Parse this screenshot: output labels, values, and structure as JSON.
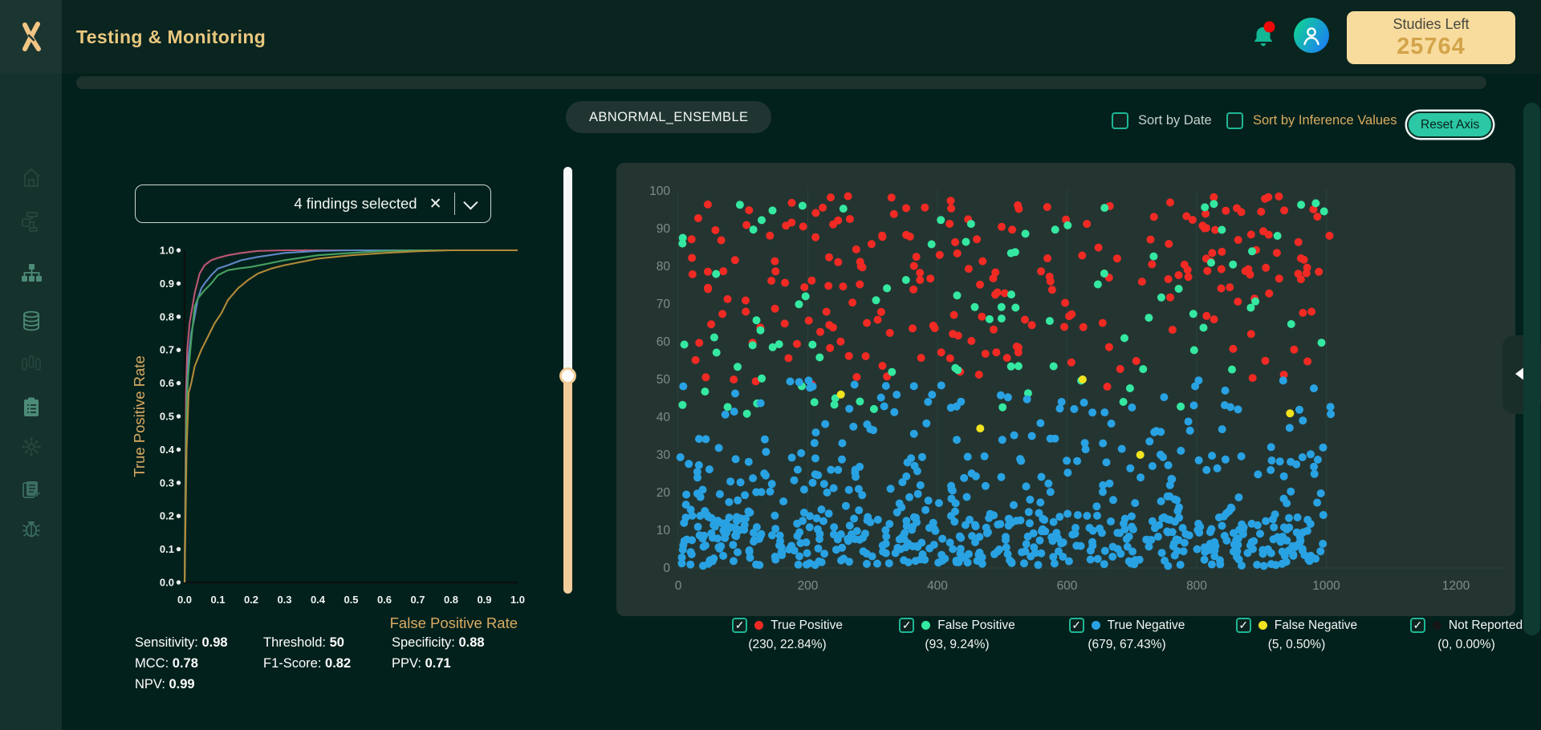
{
  "app": {
    "title": "Testing & Monitoring"
  },
  "theme": {
    "accent_teal": "#1db795",
    "accent_gold": "#d9ab61",
    "page_bg": "#03211c",
    "card_bg": "#243531",
    "studies_card_bg": "#f8dc9e"
  },
  "header": {
    "notification": {
      "icon": "bell-icon",
      "has_unread_badge": true
    },
    "user": {
      "icon": "user-avatar"
    },
    "studies_card": {
      "label": "Studies Left",
      "value": "25764"
    }
  },
  "sidebar": {
    "items": [
      {
        "name": "home",
        "tone": "dim"
      },
      {
        "name": "workflow",
        "tone": "dim"
      },
      {
        "name": "hierarchy",
        "tone": "bright"
      },
      {
        "name": "database",
        "tone": "bright"
      },
      {
        "name": "samples",
        "tone": "dim"
      },
      {
        "name": "checklist",
        "tone": "bright"
      },
      {
        "name": "network",
        "tone": "dim"
      },
      {
        "name": "reports",
        "tone": "mid"
      },
      {
        "name": "debug",
        "tone": "mid"
      }
    ]
  },
  "toolbar": {
    "model_name": "ABNORMAL_ENSEMBLE",
    "sort_by_date": {
      "label": "Sort by Date",
      "checked": false
    },
    "sort_by_inference": {
      "label": "Sort by Inference Values",
      "checked": false
    },
    "reset_axis": {
      "label": "Reset Axis"
    }
  },
  "findings_select": {
    "value": "4 findings selected",
    "clear_icon": "✕"
  },
  "metrics": {
    "items": [
      {
        "label": "Sensitivity:",
        "value": "0.98"
      },
      {
        "label": "Threshold:",
        "value": "50"
      },
      {
        "label": "Specificity:",
        "value": "0.88"
      },
      {
        "label": "MCC:",
        "value": "0.78"
      },
      {
        "label": "F1-Score:",
        "value": "0.82"
      },
      {
        "label": "PPV:",
        "value": "0.71"
      },
      {
        "label": "NPV:",
        "value": "0.99"
      }
    ]
  },
  "slider": {
    "orientation": "vertical",
    "value_fraction": 0.49
  },
  "chart_data": [
    {
      "id": "roc-curve",
      "type": "line",
      "xlabel": "False Positive Rate",
      "ylabel": "True Positive Rate",
      "xlim": [
        0,
        1
      ],
      "ylim": [
        0,
        1
      ],
      "xticks": [
        "0.0",
        "0.1",
        "0.2",
        "0.3",
        "0.4",
        "0.5",
        "0.6",
        "0.7",
        "0.8",
        "0.9",
        "1.0"
      ],
      "yticks": [
        "0.0",
        "0.1",
        "0.2",
        "0.3",
        "0.4",
        "0.5",
        "0.6",
        "0.7",
        "0.8",
        "0.9",
        "1.0"
      ],
      "grid": false,
      "series": [
        {
          "name": "finding-roc-1",
          "color": "#bd5674",
          "points": [
            [
              0,
              0
            ],
            [
              0.004,
              0.57
            ],
            [
              0.008,
              0.7
            ],
            [
              0.015,
              0.78
            ],
            [
              0.03,
              0.87
            ],
            [
              0.045,
              0.93
            ],
            [
              0.06,
              0.955
            ],
            [
              0.08,
              0.97
            ],
            [
              0.1,
              0.977
            ],
            [
              0.13,
              0.985
            ],
            [
              0.17,
              0.992
            ],
            [
              0.22,
              0.998
            ],
            [
              0.3,
              1
            ],
            [
              1,
              1
            ]
          ]
        },
        {
          "name": "finding-roc-2",
          "color": "#5f86c6",
          "points": [
            [
              0,
              0
            ],
            [
              0.004,
              0.45
            ],
            [
              0.008,
              0.6
            ],
            [
              0.012,
              0.68
            ],
            [
              0.02,
              0.75
            ],
            [
              0.03,
              0.8
            ],
            [
              0.04,
              0.855
            ],
            [
              0.05,
              0.885
            ],
            [
              0.06,
              0.9
            ],
            [
              0.08,
              0.925
            ],
            [
              0.1,
              0.945
            ],
            [
              0.13,
              0.955
            ],
            [
              0.17,
              0.97
            ],
            [
              0.22,
              0.98
            ],
            [
              0.3,
              0.992
            ],
            [
              0.4,
              0.998
            ],
            [
              0.5,
              1
            ],
            [
              1,
              1
            ]
          ]
        },
        {
          "name": "finding-roc-3",
          "color": "#47a061",
          "points": [
            [
              0,
              0
            ],
            [
              0.005,
              0.5
            ],
            [
              0.01,
              0.62
            ],
            [
              0.02,
              0.73
            ],
            [
              0.03,
              0.83
            ],
            [
              0.04,
              0.855
            ],
            [
              0.06,
              0.88
            ],
            [
              0.08,
              0.9
            ],
            [
              0.1,
              0.925
            ],
            [
              0.13,
              0.94
            ],
            [
              0.16,
              0.945
            ],
            [
              0.2,
              0.95
            ],
            [
              0.25,
              0.96
            ],
            [
              0.3,
              0.97
            ],
            [
              0.4,
              0.985
            ],
            [
              0.5,
              0.992
            ],
            [
              0.6,
              0.998
            ],
            [
              0.7,
              1
            ],
            [
              1,
              1
            ]
          ]
        },
        {
          "name": "finding-roc-4",
          "color": "#b18a38",
          "points": [
            [
              0,
              0
            ],
            [
              0.006,
              0.4
            ],
            [
              0.012,
              0.57
            ],
            [
              0.02,
              0.6
            ],
            [
              0.03,
              0.65
            ],
            [
              0.05,
              0.7
            ],
            [
              0.07,
              0.74
            ],
            [
              0.09,
              0.78
            ],
            [
              0.11,
              0.81
            ],
            [
              0.13,
              0.85
            ],
            [
              0.16,
              0.885
            ],
            [
              0.19,
              0.91
            ],
            [
              0.22,
              0.93
            ],
            [
              0.26,
              0.945
            ],
            [
              0.3,
              0.955
            ],
            [
              0.35,
              0.965
            ],
            [
              0.4,
              0.975
            ],
            [
              0.5,
              0.985
            ],
            [
              0.6,
              0.992
            ],
            [
              0.7,
              0.997
            ],
            [
              0.8,
              1
            ],
            [
              1,
              1
            ]
          ]
        }
      ]
    },
    {
      "id": "inference-scatter",
      "type": "scatter",
      "xlim": [
        0,
        1240
      ],
      "ylim": [
        0,
        103
      ],
      "xticks": [
        0,
        200,
        400,
        600,
        800,
        1000,
        1200
      ],
      "yticks": [
        0,
        10,
        20,
        30,
        40,
        50,
        60,
        70,
        80,
        90,
        100
      ],
      "grid": "vertical",
      "legend_position": "bottom",
      "seed": 20,
      "series": [
        {
          "name": "True Positive",
          "color": "#f12a24",
          "count": 230,
          "stat": "(230, 22.84%)",
          "checked": true,
          "x_range": [
            2,
            1008
          ],
          "y_range": [
            48,
            99
          ],
          "distribution": "top-bias"
        },
        {
          "name": "False Positive",
          "color": "#35e8a1",
          "count": 93,
          "stat": "(93, 9.24%)",
          "checked": true,
          "x_range": [
            2,
            1008
          ],
          "y_range": [
            40,
            97
          ],
          "distribution": "uniform"
        },
        {
          "name": "True Negative",
          "color": "#29a2e3",
          "count": 679,
          "stat": "(679, 67.43%)",
          "checked": true,
          "x_range": [
            2,
            1008
          ],
          "y_range": [
            0,
            50
          ],
          "distribution": "bottom-heavy"
        },
        {
          "name": "False Negative",
          "color": "#f1e320",
          "count": 5,
          "stat": "(5, 0.50%)",
          "checked": true,
          "points": [
            [
              251,
              46
            ],
            [
              466,
              37
            ],
            [
              624,
              50
            ],
            [
              713,
              30
            ],
            [
              944,
              41
            ]
          ]
        },
        {
          "name": "Not Reported",
          "color": "#151515",
          "count": 0,
          "stat": "(0, 0.00%)",
          "checked": true,
          "points": []
        }
      ]
    }
  ]
}
